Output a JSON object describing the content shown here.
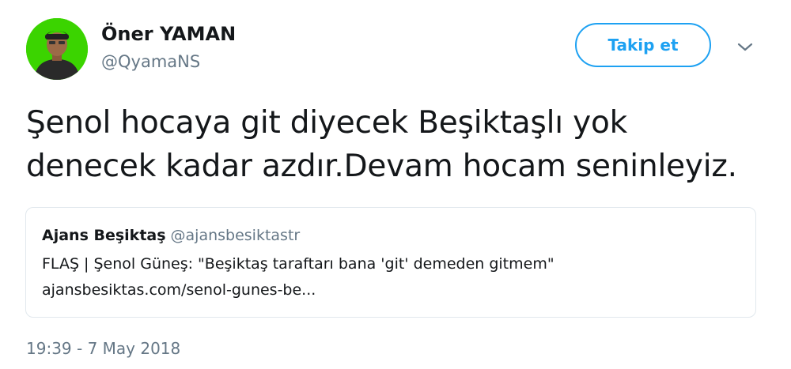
{
  "author": {
    "display_name": "Öner YAMAN",
    "handle": "@QyamaNS",
    "avatar_background": "#3bd400"
  },
  "actions": {
    "follow_label": "Takip et",
    "menu_icon": "chevron-down-icon"
  },
  "tweet": {
    "text_line_1": "Şenol hocaya git diyecek Beşiktaşlı yok",
    "text_line_2": "denecek kadar azdır.Devam hocam seninleyiz.",
    "timestamp": "19:39 - 7 May 2018"
  },
  "quoted_tweet": {
    "display_name": "Ajans Beşiktaş",
    "handle": "@ajansbesiktastr",
    "text_line_1": "FLAŞ | Şenol Güneş: \"Beşiktaş taraftarı bana 'git' demeden gitmem\"",
    "text_line_2": "ajansbesiktas.com/senol-gunes-be..."
  },
  "colors": {
    "accent": "#1da1f2",
    "primary_text": "#14171a",
    "secondary_text": "#657786",
    "border": "#e1e8ed"
  }
}
